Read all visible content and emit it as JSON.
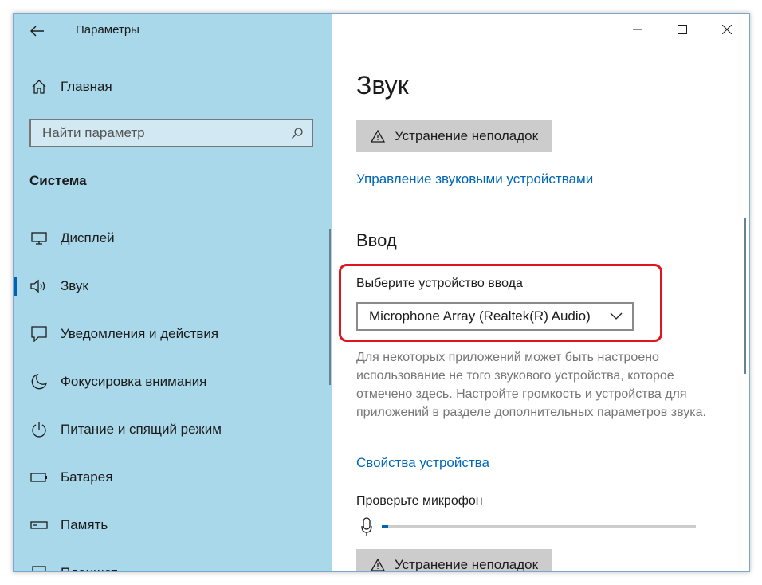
{
  "window": {
    "app_title": "Параметры",
    "controls": {
      "minimize": "—",
      "maximize": "☐",
      "close": "✕"
    }
  },
  "sidebar": {
    "home_label": "Главная",
    "search_placeholder": "Найти параметр",
    "section_label": "Система",
    "items": [
      {
        "label": "Дисплей",
        "icon": "display-icon"
      },
      {
        "label": "Звук",
        "icon": "speaker-icon",
        "active": true
      },
      {
        "label": "Уведомления и действия",
        "icon": "notification-icon"
      },
      {
        "label": "Фокусировка внимания",
        "icon": "moon-icon"
      },
      {
        "label": "Питание и спящий режим",
        "icon": "power-icon"
      },
      {
        "label": "Батарея",
        "icon": "battery-icon"
      },
      {
        "label": "Память",
        "icon": "storage-icon"
      },
      {
        "label": "Планшет",
        "icon": "tablet-icon"
      }
    ]
  },
  "main": {
    "title": "Звук",
    "troubleshoot_label": "Устранение неполадок",
    "manage_devices_link": "Управление звуковыми устройствами",
    "input_heading": "Ввод",
    "choose_input_label": "Выберите устройство ввода",
    "selected_input_device": "Microphone Array (Realtek(R) Audio)",
    "description": "Для некоторых приложений может быть настроено использование не того звукового устройства, которое отмечено здесь. Настройте громкость и устройства для приложений в разделе дополнительных параметров звука.",
    "device_properties_link": "Свойства устройства",
    "test_mic_label": "Проверьте микрофон",
    "mic_level": 0.02,
    "troubleshoot_label_2": "Устранение неполадок"
  },
  "colors": {
    "sidebar_bg": "#a9d8ea",
    "accent": "#0063b1",
    "link": "#0067b8",
    "highlight_border": "#e0161e"
  }
}
